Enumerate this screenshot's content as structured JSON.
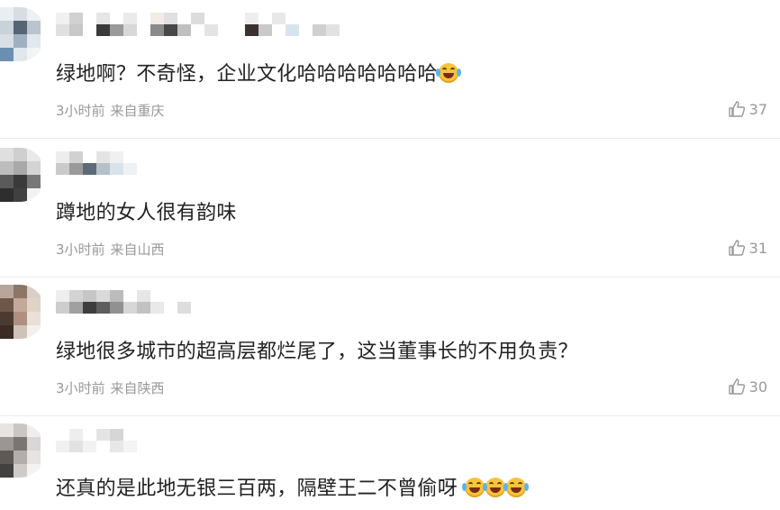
{
  "comments": [
    {
      "text": "绿地啊？不奇怪，企业文化哈哈哈哈哈哈哈",
      "emoji": "laughing-tears-emoji",
      "time": "3小时前",
      "location": "来自重庆",
      "likes": "37"
    },
    {
      "text": "蹲地的女人很有韵味",
      "time": "3小时前",
      "location": "来自山西",
      "likes": "31"
    },
    {
      "text": "绿地很多城市的超高层都烂尾了，这当董事长的不用负责？",
      "time": "3小时前",
      "location": "来自陕西",
      "likes": "30"
    },
    {
      "text": "还真的是此地无银三百两，隔壁王二不曾偷呀",
      "emoji": "crying-emoji ×3"
    }
  ],
  "colors": {
    "meta": "#999999",
    "text": "#222222",
    "divider": "#ececec",
    "emoji": "#f7c43a"
  }
}
